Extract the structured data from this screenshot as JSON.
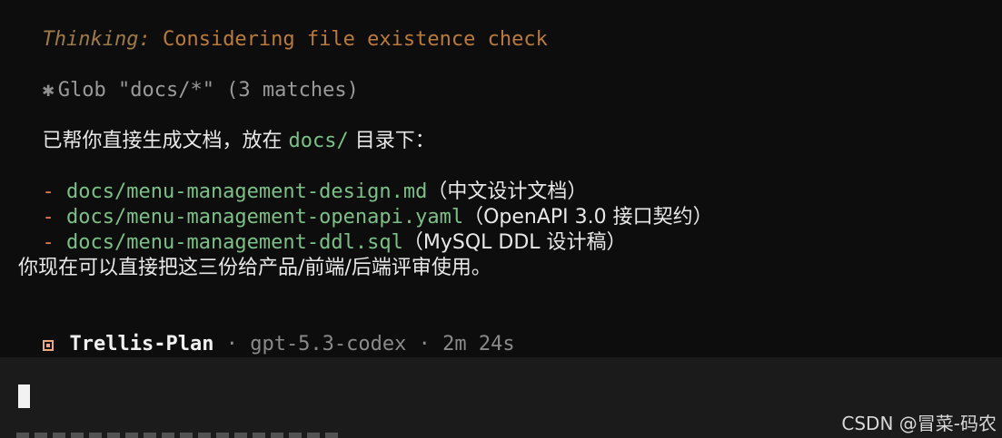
{
  "thinking": {
    "label": "Thinking:",
    "text": " Considering file existence check"
  },
  "glob": {
    "icon": "asterisk-icon",
    "text": "Glob \"docs/*\" (3 matches)"
  },
  "message": {
    "intro_prefix": "已帮你直接生成文档，放在 ",
    "intro_path": "docs/",
    "intro_suffix": " 目录下：",
    "files": [
      {
        "path": "docs/menu-management-design.md",
        "desc": "（中文设计文档）"
      },
      {
        "path": "docs/menu-management-openapi.yaml",
        "desc": "（OpenAPI 3.0 接口契约）"
      },
      {
        "path": "docs/menu-management-ddl.sql",
        "desc": "（MySQL DDL 设计稿）"
      }
    ],
    "closing": "你现在可以直接把这三份给产品/前端/后端评审使用。"
  },
  "status": {
    "icon": "status-square-icon",
    "name": "Trellis-Plan",
    "separator": " · ",
    "model": "gpt-5.3-codex",
    "duration": "2m 24s"
  },
  "watermark": {
    "text": "CSDN @冒菜-码农"
  },
  "colors": {
    "background": "#0d0d0d",
    "panel": "#1b1b1b",
    "thinking": "#b97a3a",
    "path": "#7cc088",
    "dash": "#e07b50",
    "muted": "#8a8a8a",
    "status_icon": "#e9a87d"
  }
}
